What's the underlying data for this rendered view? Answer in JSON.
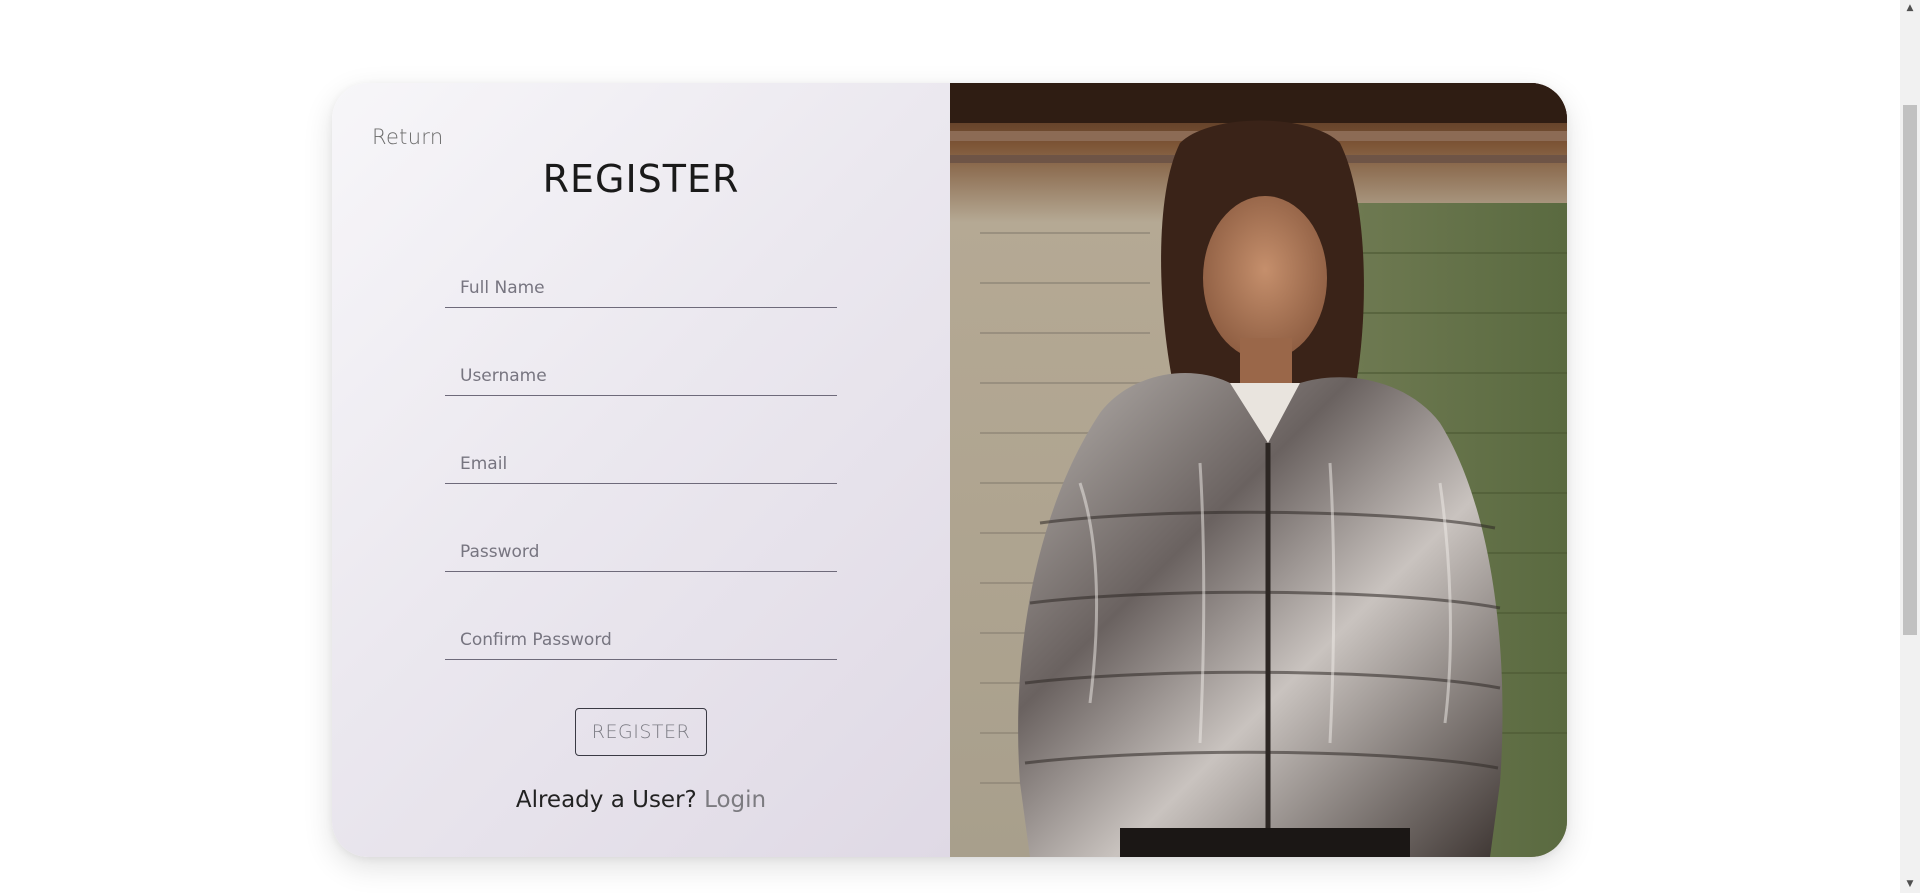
{
  "page": {
    "return_label": "Return",
    "title": "REGISTER"
  },
  "form": {
    "fields": [
      {
        "placeholder": "Full Name",
        "value": ""
      },
      {
        "placeholder": "Username",
        "value": ""
      },
      {
        "placeholder": "Email",
        "value": ""
      },
      {
        "placeholder": "Password",
        "value": ""
      },
      {
        "placeholder": "Confirm Password",
        "value": ""
      }
    ],
    "submit_label": "REGISTER"
  },
  "footer": {
    "prompt": "Already a User?",
    "login_label": "Login"
  },
  "colors": {
    "panel_gradient_start": "#f7f6f9",
    "panel_gradient_end": "#dfd9e5",
    "text_dark": "#1a1a1a",
    "link_gray": "#7c7b80"
  },
  "icons": {
    "scroll_up": "scroll-up-arrow-icon",
    "scroll_down": "scroll-down-arrow-icon"
  }
}
